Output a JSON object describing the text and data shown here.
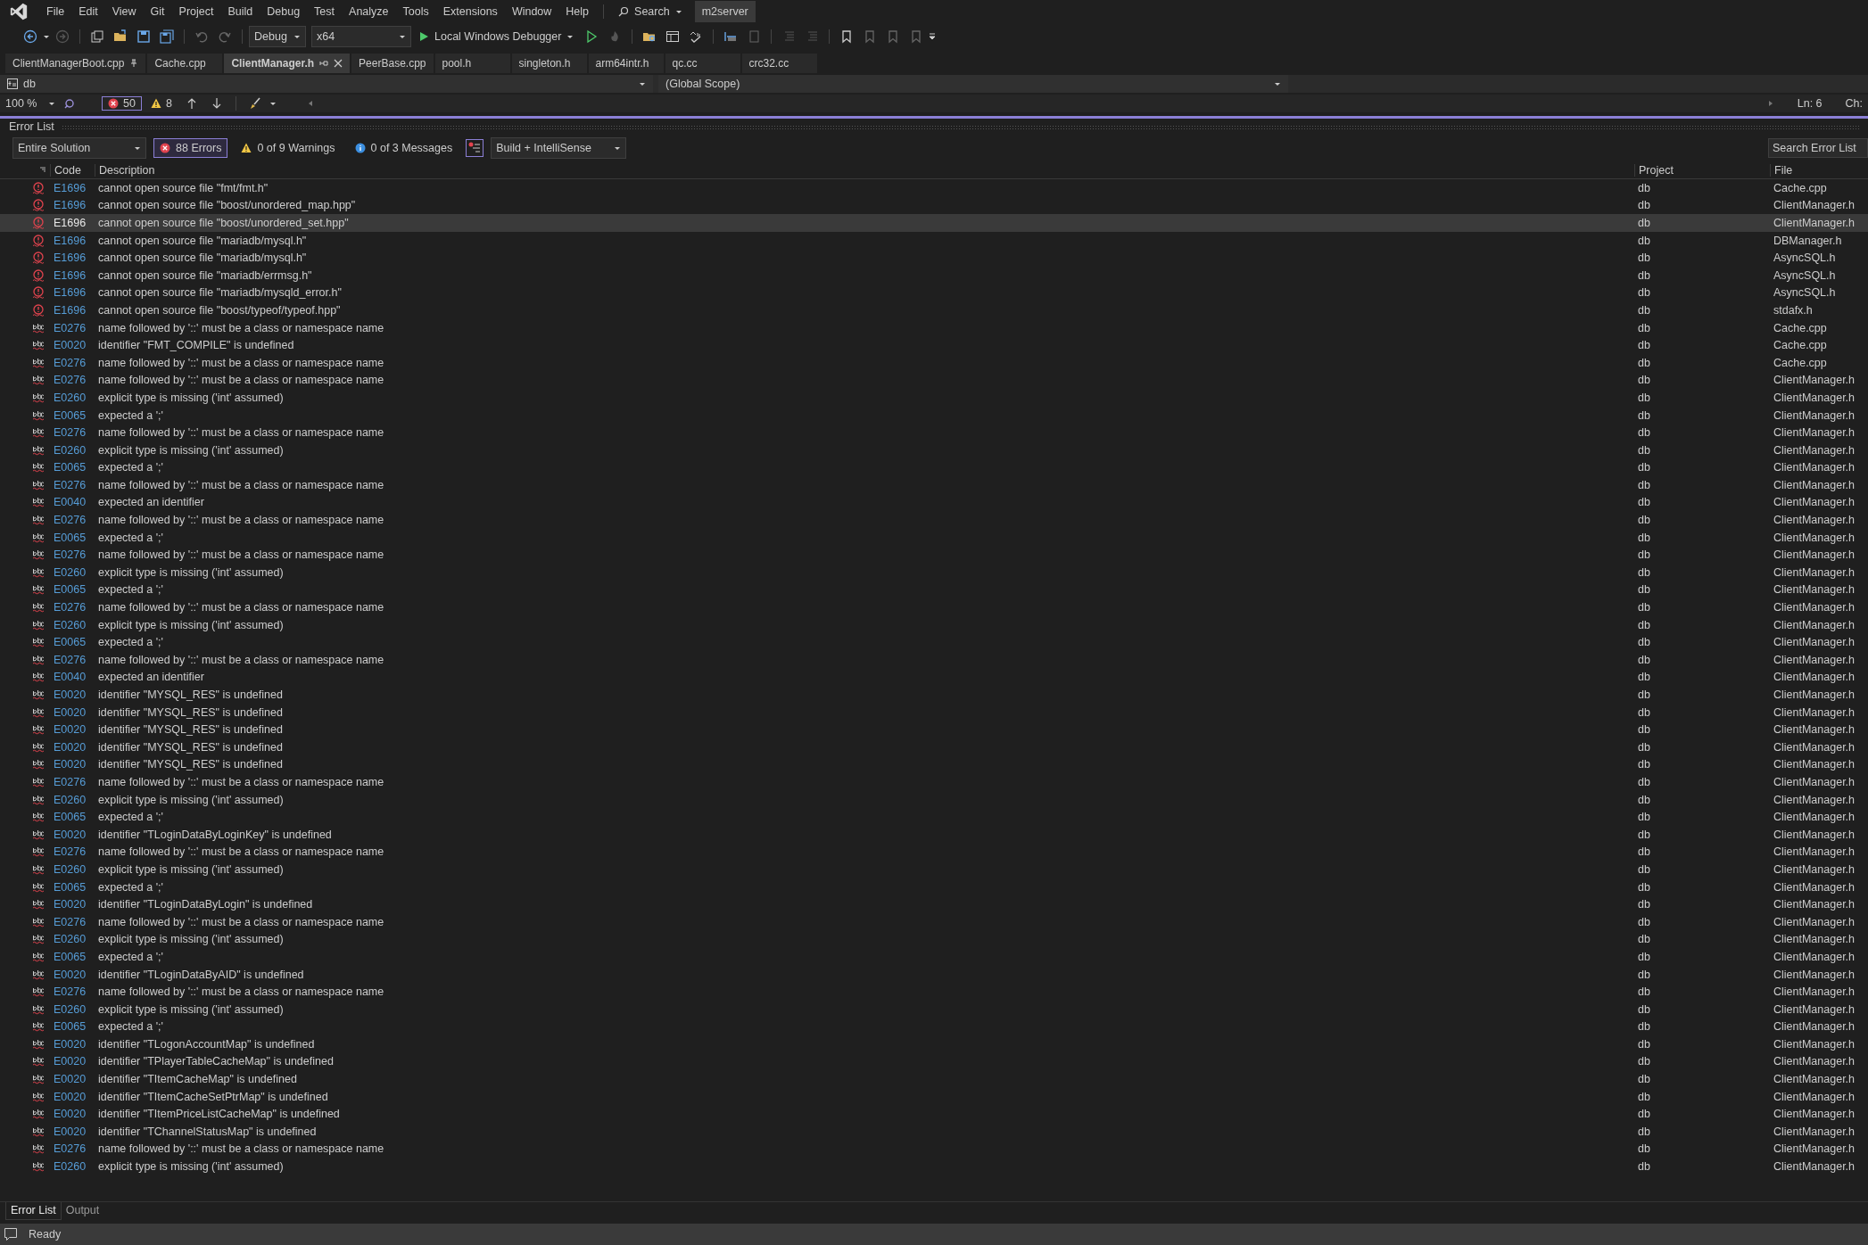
{
  "menu": [
    "File",
    "Edit",
    "View",
    "Git",
    "Project",
    "Build",
    "Debug",
    "Test",
    "Analyze",
    "Tools",
    "Extensions",
    "Window",
    "Help"
  ],
  "search": {
    "label": "Search"
  },
  "solution": "m2server",
  "toolbar": {
    "configuration": "Debug",
    "platform": "x64",
    "debugger": "Local Windows Debugger"
  },
  "tabs": [
    {
      "label": "ClientManagerBoot.cpp",
      "selected": false,
      "pinned": true
    },
    {
      "label": "Cache.cpp",
      "selected": false,
      "pinned": false
    },
    {
      "label": "ClientManager.h",
      "selected": true,
      "pinned": false
    },
    {
      "label": "PeerBase.cpp",
      "selected": false,
      "pinned": false
    },
    {
      "label": "pool.h",
      "selected": false,
      "pinned": false
    },
    {
      "label": "singleton.h",
      "selected": false,
      "pinned": false
    },
    {
      "label": "arm64intr.h",
      "selected": false,
      "pinned": false
    },
    {
      "label": "qc.cc",
      "selected": false,
      "pinned": false
    },
    {
      "label": "crc32.cc",
      "selected": false,
      "pinned": false
    }
  ],
  "nav": {
    "project": "db",
    "scope": "(Global Scope)"
  },
  "editor_bar": {
    "zoom": "100 %",
    "errors": "50",
    "warnings": "8",
    "line": "Ln: 6",
    "column": "Ch:"
  },
  "error_list": {
    "title": "Error List",
    "scope": "Entire Solution",
    "filters": [
      {
        "kind": "error",
        "label": "88 Errors",
        "on": true
      },
      {
        "kind": "warning",
        "label": "0 of 9 Warnings",
        "on": false
      },
      {
        "kind": "message",
        "label": "0 of 3 Messages",
        "on": false
      }
    ],
    "source": "Build + IntelliSense",
    "search_placeholder": "Search Error List",
    "columns": [
      "Code",
      "Description",
      "Project",
      "File"
    ],
    "rows": [
      {
        "kind": "error",
        "code": "E1696",
        "description": "cannot open source file \"fmt/fmt.h\"",
        "project": "db",
        "file": "Cache.cpp",
        "selected": false
      },
      {
        "kind": "error",
        "code": "E1696",
        "description": "cannot open source file \"boost/unordered_map.hpp\"",
        "project": "db",
        "file": "ClientManager.h",
        "selected": false
      },
      {
        "kind": "error",
        "code": "E1696",
        "description": "cannot open source file \"boost/unordered_set.hpp\"",
        "project": "db",
        "file": "ClientManager.h",
        "selected": true
      },
      {
        "kind": "error",
        "code": "E1696",
        "description": "cannot open source file \"mariadb/mysql.h\"",
        "project": "db",
        "file": "DBManager.h",
        "selected": false
      },
      {
        "kind": "error",
        "code": "E1696",
        "description": "cannot open source file \"mariadb/mysql.h\"",
        "project": "db",
        "file": "AsyncSQL.h",
        "selected": false
      },
      {
        "kind": "error",
        "code": "E1696",
        "description": "cannot open source file \"mariadb/errmsg.h\"",
        "project": "db",
        "file": "AsyncSQL.h",
        "selected": false
      },
      {
        "kind": "error",
        "code": "E1696",
        "description": "cannot open source file \"mariadb/mysqld_error.h\"",
        "project": "db",
        "file": "AsyncSQL.h",
        "selected": false
      },
      {
        "kind": "error",
        "code": "E1696",
        "description": "cannot open source file \"boost/typeof/typeof.hpp\"",
        "project": "db",
        "file": "stdafx.h",
        "selected": false
      },
      {
        "kind": "intellisense",
        "code": "E0276",
        "description": "name followed by '::' must be a class or namespace name",
        "project": "db",
        "file": "Cache.cpp",
        "selected": false
      },
      {
        "kind": "intellisense",
        "code": "E0020",
        "description": "identifier \"FMT_COMPILE\" is undefined",
        "project": "db",
        "file": "Cache.cpp",
        "selected": false
      },
      {
        "kind": "intellisense",
        "code": "E0276",
        "description": "name followed by '::' must be a class or namespace name",
        "project": "db",
        "file": "Cache.cpp",
        "selected": false
      },
      {
        "kind": "intellisense",
        "code": "E0276",
        "description": "name followed by '::' must be a class or namespace name",
        "project": "db",
        "file": "ClientManager.h",
        "selected": false
      },
      {
        "kind": "intellisense",
        "code": "E0260",
        "description": "explicit type is missing ('int' assumed)",
        "project": "db",
        "file": "ClientManager.h",
        "selected": false
      },
      {
        "kind": "intellisense",
        "code": "E0065",
        "description": "expected a ';'",
        "project": "db",
        "file": "ClientManager.h",
        "selected": false
      },
      {
        "kind": "intellisense",
        "code": "E0276",
        "description": "name followed by '::' must be a class or namespace name",
        "project": "db",
        "file": "ClientManager.h",
        "selected": false
      },
      {
        "kind": "intellisense",
        "code": "E0260",
        "description": "explicit type is missing ('int' assumed)",
        "project": "db",
        "file": "ClientManager.h",
        "selected": false
      },
      {
        "kind": "intellisense",
        "code": "E0065",
        "description": "expected a ';'",
        "project": "db",
        "file": "ClientManager.h",
        "selected": false
      },
      {
        "kind": "intellisense",
        "code": "E0276",
        "description": "name followed by '::' must be a class or namespace name",
        "project": "db",
        "file": "ClientManager.h",
        "selected": false
      },
      {
        "kind": "intellisense",
        "code": "E0040",
        "description": "expected an identifier",
        "project": "db",
        "file": "ClientManager.h",
        "selected": false
      },
      {
        "kind": "intellisense",
        "code": "E0276",
        "description": "name followed by '::' must be a class or namespace name",
        "project": "db",
        "file": "ClientManager.h",
        "selected": false
      },
      {
        "kind": "intellisense",
        "code": "E0065",
        "description": "expected a ';'",
        "project": "db",
        "file": "ClientManager.h",
        "selected": false
      },
      {
        "kind": "intellisense",
        "code": "E0276",
        "description": "name followed by '::' must be a class or namespace name",
        "project": "db",
        "file": "ClientManager.h",
        "selected": false
      },
      {
        "kind": "intellisense",
        "code": "E0260",
        "description": "explicit type is missing ('int' assumed)",
        "project": "db",
        "file": "ClientManager.h",
        "selected": false
      },
      {
        "kind": "intellisense",
        "code": "E0065",
        "description": "expected a ';'",
        "project": "db",
        "file": "ClientManager.h",
        "selected": false
      },
      {
        "kind": "intellisense",
        "code": "E0276",
        "description": "name followed by '::' must be a class or namespace name",
        "project": "db",
        "file": "ClientManager.h",
        "selected": false
      },
      {
        "kind": "intellisense",
        "code": "E0260",
        "description": "explicit type is missing ('int' assumed)",
        "project": "db",
        "file": "ClientManager.h",
        "selected": false
      },
      {
        "kind": "intellisense",
        "code": "E0065",
        "description": "expected a ';'",
        "project": "db",
        "file": "ClientManager.h",
        "selected": false
      },
      {
        "kind": "intellisense",
        "code": "E0276",
        "description": "name followed by '::' must be a class or namespace name",
        "project": "db",
        "file": "ClientManager.h",
        "selected": false
      },
      {
        "kind": "intellisense",
        "code": "E0040",
        "description": "expected an identifier",
        "project": "db",
        "file": "ClientManager.h",
        "selected": false
      },
      {
        "kind": "intellisense",
        "code": "E0020",
        "description": "identifier \"MYSQL_RES\" is undefined",
        "project": "db",
        "file": "ClientManager.h",
        "selected": false
      },
      {
        "kind": "intellisense",
        "code": "E0020",
        "description": "identifier \"MYSQL_RES\" is undefined",
        "project": "db",
        "file": "ClientManager.h",
        "selected": false
      },
      {
        "kind": "intellisense",
        "code": "E0020",
        "description": "identifier \"MYSQL_RES\" is undefined",
        "project": "db",
        "file": "ClientManager.h",
        "selected": false
      },
      {
        "kind": "intellisense",
        "code": "E0020",
        "description": "identifier \"MYSQL_RES\" is undefined",
        "project": "db",
        "file": "ClientManager.h",
        "selected": false
      },
      {
        "kind": "intellisense",
        "code": "E0020",
        "description": "identifier \"MYSQL_RES\" is undefined",
        "project": "db",
        "file": "ClientManager.h",
        "selected": false
      },
      {
        "kind": "intellisense",
        "code": "E0276",
        "description": "name followed by '::' must be a class or namespace name",
        "project": "db",
        "file": "ClientManager.h",
        "selected": false
      },
      {
        "kind": "intellisense",
        "code": "E0260",
        "description": "explicit type is missing ('int' assumed)",
        "project": "db",
        "file": "ClientManager.h",
        "selected": false
      },
      {
        "kind": "intellisense",
        "code": "E0065",
        "description": "expected a ';'",
        "project": "db",
        "file": "ClientManager.h",
        "selected": false
      },
      {
        "kind": "intellisense",
        "code": "E0020",
        "description": "identifier \"TLoginDataByLoginKey\" is undefined",
        "project": "db",
        "file": "ClientManager.h",
        "selected": false
      },
      {
        "kind": "intellisense",
        "code": "E0276",
        "description": "name followed by '::' must be a class or namespace name",
        "project": "db",
        "file": "ClientManager.h",
        "selected": false
      },
      {
        "kind": "intellisense",
        "code": "E0260",
        "description": "explicit type is missing ('int' assumed)",
        "project": "db",
        "file": "ClientManager.h",
        "selected": false
      },
      {
        "kind": "intellisense",
        "code": "E0065",
        "description": "expected a ';'",
        "project": "db",
        "file": "ClientManager.h",
        "selected": false
      },
      {
        "kind": "intellisense",
        "code": "E0020",
        "description": "identifier \"TLoginDataByLogin\" is undefined",
        "project": "db",
        "file": "ClientManager.h",
        "selected": false
      },
      {
        "kind": "intellisense",
        "code": "E0276",
        "description": "name followed by '::' must be a class or namespace name",
        "project": "db",
        "file": "ClientManager.h",
        "selected": false
      },
      {
        "kind": "intellisense",
        "code": "E0260",
        "description": "explicit type is missing ('int' assumed)",
        "project": "db",
        "file": "ClientManager.h",
        "selected": false
      },
      {
        "kind": "intellisense",
        "code": "E0065",
        "description": "expected a ';'",
        "project": "db",
        "file": "ClientManager.h",
        "selected": false
      },
      {
        "kind": "intellisense",
        "code": "E0020",
        "description": "identifier \"TLoginDataByAID\" is undefined",
        "project": "db",
        "file": "ClientManager.h",
        "selected": false
      },
      {
        "kind": "intellisense",
        "code": "E0276",
        "description": "name followed by '::' must be a class or namespace name",
        "project": "db",
        "file": "ClientManager.h",
        "selected": false
      },
      {
        "kind": "intellisense",
        "code": "E0260",
        "description": "explicit type is missing ('int' assumed)",
        "project": "db",
        "file": "ClientManager.h",
        "selected": false
      },
      {
        "kind": "intellisense",
        "code": "E0065",
        "description": "expected a ';'",
        "project": "db",
        "file": "ClientManager.h",
        "selected": false
      },
      {
        "kind": "intellisense",
        "code": "E0020",
        "description": "identifier \"TLogonAccountMap\" is undefined",
        "project": "db",
        "file": "ClientManager.h",
        "selected": false
      },
      {
        "kind": "intellisense",
        "code": "E0020",
        "description": "identifier \"TPlayerTableCacheMap\" is undefined",
        "project": "db",
        "file": "ClientManager.h",
        "selected": false
      },
      {
        "kind": "intellisense",
        "code": "E0020",
        "description": "identifier \"TItemCacheMap\" is undefined",
        "project": "db",
        "file": "ClientManager.h",
        "selected": false
      },
      {
        "kind": "intellisense",
        "code": "E0020",
        "description": "identifier \"TItemCacheSetPtrMap\" is undefined",
        "project": "db",
        "file": "ClientManager.h",
        "selected": false
      },
      {
        "kind": "intellisense",
        "code": "E0020",
        "description": "identifier \"TItemPriceListCacheMap\" is undefined",
        "project": "db",
        "file": "ClientManager.h",
        "selected": false
      },
      {
        "kind": "intellisense",
        "code": "E0020",
        "description": "identifier \"TChannelStatusMap\" is undefined",
        "project": "db",
        "file": "ClientManager.h",
        "selected": false
      },
      {
        "kind": "intellisense",
        "code": "E0276",
        "description": "name followed by '::' must be a class or namespace name",
        "project": "db",
        "file": "ClientManager.h",
        "selected": false
      },
      {
        "kind": "intellisense",
        "code": "E0260",
        "description": "explicit type is missing ('int' assumed)",
        "project": "db",
        "file": "ClientManager.h",
        "selected": false
      }
    ]
  },
  "panel_tabs": [
    {
      "label": "Error List",
      "selected": true
    },
    {
      "label": "Output",
      "selected": false
    }
  ],
  "status_bar": {
    "text": "Ready"
  }
}
